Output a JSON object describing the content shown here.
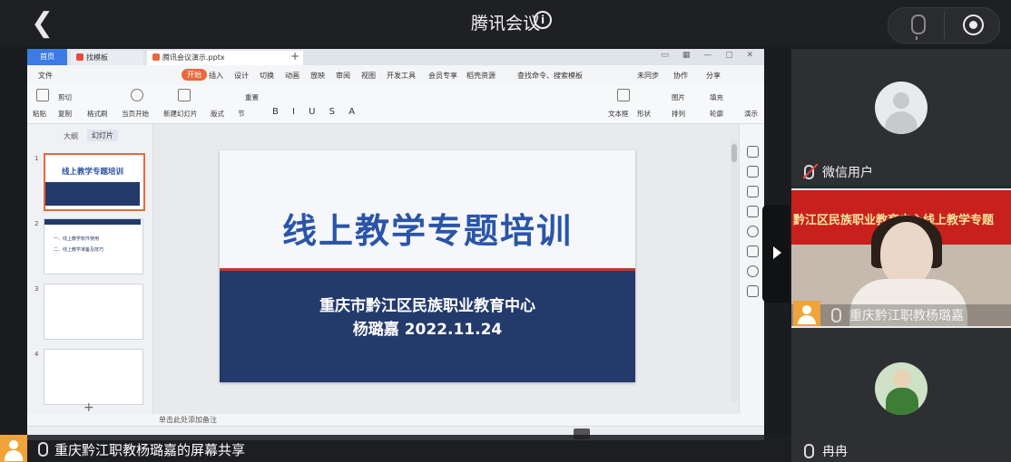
{
  "meeting": {
    "title": "腾讯会议",
    "share_label": "重庆黔江职教杨璐嘉的屏幕共享"
  },
  "wps": {
    "tabs": {
      "home": "首页",
      "template": "找模板",
      "file": "腾讯会议演示.pptx"
    },
    "menu": [
      "文件",
      "开始",
      "插入",
      "设计",
      "切换",
      "动画",
      "放映",
      "审阅",
      "视图",
      "开发工具",
      "会员专享",
      "稻壳资源"
    ],
    "search_placeholder": "查找命令、搜索模板",
    "sync": "未同步",
    "collab": "协作",
    "share": "分享",
    "ribbon": [
      "粘贴",
      "剪切",
      "复制",
      "格式刷",
      "当页开始",
      "新建幻灯片",
      "版式",
      "节",
      "重置",
      "文本框",
      "形状",
      "图片",
      "排列",
      "轮廓",
      "填充",
      "演示"
    ],
    "panel_tabs": {
      "outline": "大纲",
      "slides": "幻灯片"
    },
    "thumbs": [
      {
        "num": "1",
        "title": "线上教学专题培训"
      },
      {
        "num": "2",
        "line1": "一、线上教学软件使用",
        "line2": "二、线上教学准备及技巧"
      },
      {
        "num": "3"
      },
      {
        "num": "4"
      }
    ],
    "notes_hint": "单击此处添加备注"
  },
  "slide": {
    "title": "线上教学专题培训",
    "org": "重庆市黔江区民族职业教育中心",
    "presenter_date": "杨璐嘉  2022.11.24"
  },
  "participants": [
    {
      "name": "微信用户",
      "mic": "muted"
    },
    {
      "name": "重庆黔江职教杨璐嘉",
      "mic": "on",
      "banner": "黔江区民族职业教育中心线上教学专题"
    },
    {
      "name": "冉冉",
      "mic": "on"
    }
  ]
}
